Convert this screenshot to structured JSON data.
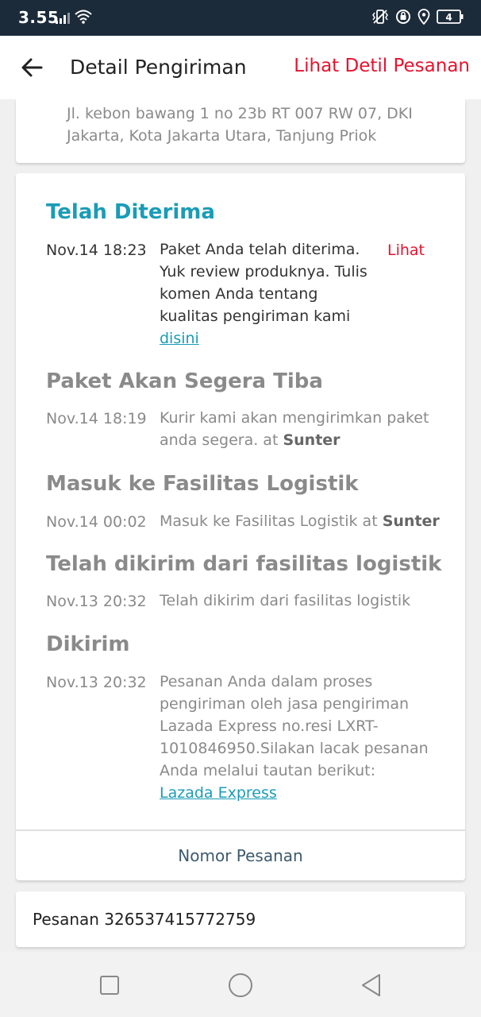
{
  "status_bar": {
    "time": "3.55",
    "battery_level": "4",
    "icons": [
      "signal-icon",
      "wifi-icon",
      "vibrate-icon",
      "data-saver-icon",
      "location-icon",
      "battery-icon"
    ]
  },
  "header": {
    "title": "Detail Pengiriman",
    "action_label": "Lihat Detil Pesanan"
  },
  "address": {
    "text": "Jl. kebon bawang 1 no 23b RT 007 RW 07, DKI Jakarta, Kota Jakarta Utara, Tanjung Priok"
  },
  "tracking": {
    "events": [
      {
        "title": "Telah Diterima",
        "time": "Nov.14 18:23",
        "description": "Paket Anda telah diterima. Yuk review produknya. Tulis komen Anda tentang kualitas pengiriman kami",
        "link_text": "disini",
        "action": "Lihat"
      },
      {
        "title": "Paket Akan Segera Tiba",
        "time": "Nov.14 18:19",
        "description": "Kurir kami akan mengirimkan paket anda segera. at",
        "location": "Sunter"
      },
      {
        "title": "Masuk ke Fasilitas Logistik",
        "time": "Nov.14 00:02",
        "description": "Masuk ke Fasilitas Logistik at",
        "location": "Sunter"
      },
      {
        "title": "Telah dikirim dari fasilitas logistik",
        "time": "Nov.13 20:32",
        "description": "Telah dikirim dari fasilitas logistik"
      },
      {
        "title": "Dikirim",
        "time": "Nov.13 20:32",
        "description": "Pesanan Anda dalam proses pengiriman oleh jasa pengiriman Lazada Express no.resi LXRT-1010846950.Silakan lacak pesanan Anda melalui tautan berikut:",
        "link_text": "Lazada Express"
      }
    ],
    "order_number_button": "Nomor Pesanan"
  },
  "order": {
    "text": "Pesanan 326537415772759"
  },
  "colors": {
    "accent": "#1a9cb7",
    "action_red": "#e8112d",
    "status_bar_bg": "#1c2b3a"
  }
}
